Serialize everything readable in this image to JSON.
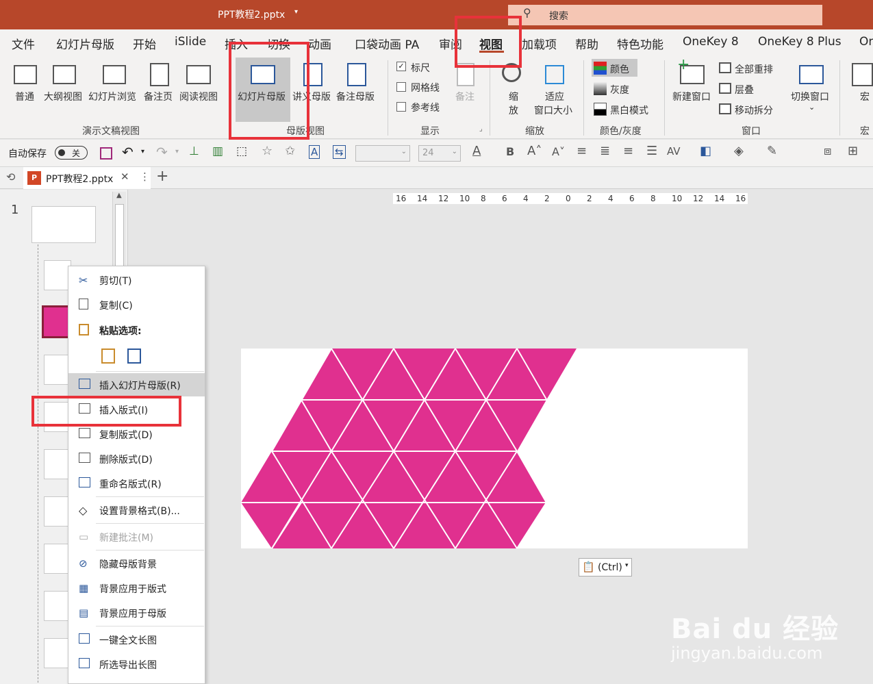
{
  "title_bar": {
    "file_name": "PPT教程2.pptx",
    "search_placeholder": "搜索"
  },
  "tabs": [
    "文件",
    "幻灯片母版",
    "开始",
    "iSlide",
    "插入",
    "切换",
    "动画",
    "口袋动画 PA",
    "审阅",
    "视图",
    "加载项",
    "帮助",
    "特色功能",
    "OneKey 8",
    "OneKey 8 Plus",
    "On"
  ],
  "ribbon": {
    "presentation_views": {
      "group": "演示文稿视图",
      "buttons": [
        "普通",
        "大纲视图",
        "幻灯片浏览",
        "备注页",
        "阅读视图"
      ]
    },
    "master_views": {
      "group": "母版视图",
      "buttons": [
        "幻灯片母版",
        "讲义母版",
        "备注母版"
      ]
    },
    "show": {
      "group": "显示",
      "checkboxes": [
        {
          "label": "标尺",
          "checked": true
        },
        {
          "label": "网格线",
          "checked": false
        },
        {
          "label": "参考线",
          "checked": false
        }
      ],
      "notes": "备注"
    },
    "zoom": {
      "group": "缩放",
      "zoom_line1": "缩",
      "zoom_line2": "放",
      "fit_line1": "适应",
      "fit_line2": "窗口大小"
    },
    "color": {
      "group": "颜色/灰度",
      "items": [
        "颜色",
        "灰度",
        "黑白模式"
      ]
    },
    "window": {
      "group": "窗口",
      "new_window": "新建窗口",
      "arrange_all": "全部重排",
      "cascade": "层叠",
      "move_split": "移动拆分",
      "switch_window": "切换窗口"
    },
    "macro": {
      "group": "宏",
      "label": "宏"
    }
  },
  "qat": {
    "autosave": "自动保存",
    "toggle": "关",
    "font_size": "24"
  },
  "document_tab": {
    "name": "PPT教程2.pptx"
  },
  "slide_pane": {
    "number": "1"
  },
  "ruler": {
    "labels": [
      "16",
      "14",
      "12",
      "10",
      "8",
      "6",
      "4",
      "2",
      "0",
      "2",
      "4",
      "6",
      "8",
      "10",
      "12",
      "14",
      "16"
    ]
  },
  "context_menu": {
    "items": [
      {
        "label": "剪切(T)",
        "icon": "scissors-icon"
      },
      {
        "label": "复制(C)",
        "icon": "copy-icon"
      },
      {
        "label": "粘贴选项:",
        "icon": "paste-icon",
        "bold": true
      },
      {
        "label": "插入幻灯片母版(R)",
        "icon": "insert-master-icon",
        "hover": true
      },
      {
        "label": "插入版式(I)",
        "icon": "insert-layout-icon"
      },
      {
        "label": "复制版式(D)",
        "icon": "duplicate-layout-icon"
      },
      {
        "label": "删除版式(D)",
        "icon": "delete-layout-icon"
      },
      {
        "label": "重命名版式(R)",
        "icon": "rename-layout-icon"
      },
      {
        "label": "设置背景格式(B)...",
        "icon": "format-background-icon"
      },
      {
        "label": "新建批注(M)",
        "icon": "new-comment-icon",
        "disabled": true
      },
      {
        "label": "隐藏母版背景",
        "icon": "hide-background-icon"
      },
      {
        "label": "背景应用于版式",
        "icon": "apply-layout-icon"
      },
      {
        "label": "背景应用于母版",
        "icon": "apply-master-icon"
      },
      {
        "label": "一键全文长图",
        "icon": "long-image-icon"
      },
      {
        "label": "所选导出长图",
        "icon": "export-image-icon"
      }
    ]
  },
  "paste_tag": {
    "label": "(Ctrl)"
  },
  "watermark": {
    "brand": "Bai du 经验",
    "url": "jingyan.baidu.com"
  },
  "colors": {
    "accent": "#b7472a",
    "triangle": "#e0308f",
    "highlight": "#e8323a"
  }
}
